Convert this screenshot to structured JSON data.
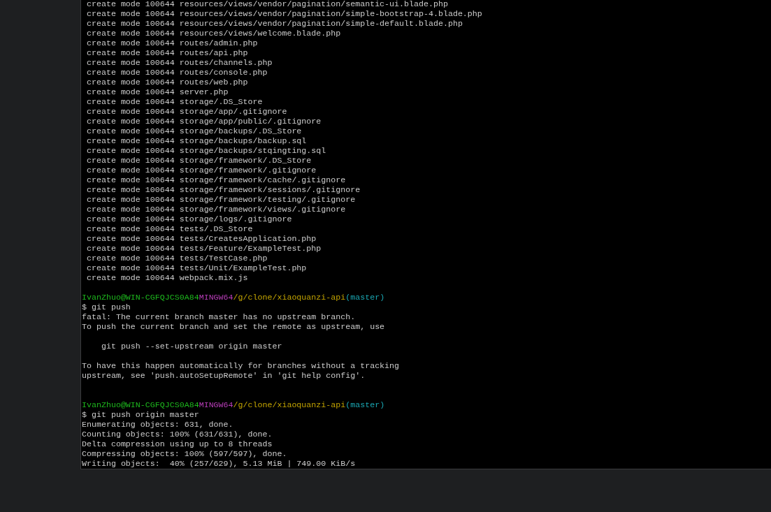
{
  "terminal": {
    "lines": [
      {
        "kind": "output",
        "text": " create mode 100644 resources/views/vendor/pagination/semantic-ui.blade.php"
      },
      {
        "kind": "output",
        "text": " create mode 100644 resources/views/vendor/pagination/simple-bootstrap-4.blade.php"
      },
      {
        "kind": "output",
        "text": " create mode 100644 resources/views/vendor/pagination/simple-default.blade.php"
      },
      {
        "kind": "output",
        "text": " create mode 100644 resources/views/welcome.blade.php"
      },
      {
        "kind": "output",
        "text": " create mode 100644 routes/admin.php"
      },
      {
        "kind": "output",
        "text": " create mode 100644 routes/api.php"
      },
      {
        "kind": "output",
        "text": " create mode 100644 routes/channels.php"
      },
      {
        "kind": "output",
        "text": " create mode 100644 routes/console.php"
      },
      {
        "kind": "output",
        "text": " create mode 100644 routes/web.php"
      },
      {
        "kind": "output",
        "text": " create mode 100644 server.php"
      },
      {
        "kind": "output",
        "text": " create mode 100644 storage/.DS_Store"
      },
      {
        "kind": "output",
        "text": " create mode 100644 storage/app/.gitignore"
      },
      {
        "kind": "output",
        "text": " create mode 100644 storage/app/public/.gitignore"
      },
      {
        "kind": "output",
        "text": " create mode 100644 storage/backups/.DS_Store"
      },
      {
        "kind": "output",
        "text": " create mode 100644 storage/backups/backup.sql"
      },
      {
        "kind": "output",
        "text": " create mode 100644 storage/backups/stqingting.sql"
      },
      {
        "kind": "output",
        "text": " create mode 100644 storage/framework/.DS_Store"
      },
      {
        "kind": "output",
        "text": " create mode 100644 storage/framework/.gitignore"
      },
      {
        "kind": "output",
        "text": " create mode 100644 storage/framework/cache/.gitignore"
      },
      {
        "kind": "output",
        "text": " create mode 100644 storage/framework/sessions/.gitignore"
      },
      {
        "kind": "output",
        "text": " create mode 100644 storage/framework/testing/.gitignore"
      },
      {
        "kind": "output",
        "text": " create mode 100644 storage/framework/views/.gitignore"
      },
      {
        "kind": "output",
        "text": " create mode 100644 storage/logs/.gitignore"
      },
      {
        "kind": "output",
        "text": " create mode 100644 tests/.DS_Store"
      },
      {
        "kind": "output",
        "text": " create mode 100644 tests/CreatesApplication.php"
      },
      {
        "kind": "output",
        "text": " create mode 100644 tests/Feature/ExampleTest.php"
      },
      {
        "kind": "output",
        "text": " create mode 100644 tests/TestCase.php"
      },
      {
        "kind": "output",
        "text": " create mode 100644 tests/Unit/ExampleTest.php"
      },
      {
        "kind": "output",
        "text": " create mode 100644 webpack.mix.js"
      },
      {
        "kind": "blank"
      },
      {
        "kind": "prompt",
        "user": "IvanZhuo@WIN-CGFQJCS0A84",
        "system": "MINGW64",
        "path": "/g/clone/xiaoquanzi-api",
        "branch": "(master)"
      },
      {
        "kind": "output",
        "text": "$ git push"
      },
      {
        "kind": "output",
        "text": "fatal: The current branch master has no upstream branch."
      },
      {
        "kind": "output",
        "text": "To push the current branch and set the remote as upstream, use"
      },
      {
        "kind": "blank"
      },
      {
        "kind": "output",
        "text": "    git push --set-upstream origin master"
      },
      {
        "kind": "blank"
      },
      {
        "kind": "output",
        "text": "To have this happen automatically for branches without a tracking"
      },
      {
        "kind": "output",
        "text": "upstream, see 'push.autoSetupRemote' in 'git help config'."
      },
      {
        "kind": "blank"
      },
      {
        "kind": "blank"
      },
      {
        "kind": "prompt",
        "user": "IvanZhuo@WIN-CGFQJCS0A84",
        "system": "MINGW64",
        "path": "/g/clone/xiaoquanzi-api",
        "branch": "(master)"
      },
      {
        "kind": "output",
        "text": "$ git push origin master"
      },
      {
        "kind": "output",
        "text": "Enumerating objects: 631, done."
      },
      {
        "kind": "output",
        "text": "Counting objects: 100% (631/631), done."
      },
      {
        "kind": "output",
        "text": "Delta compression using up to 8 threads"
      },
      {
        "kind": "output",
        "text": "Compressing objects: 100% (597/597), done."
      },
      {
        "kind": "output",
        "text": "Writing objects:  40% (257/629), 5.13 MiB | 749.00 KiB/s"
      }
    ]
  }
}
